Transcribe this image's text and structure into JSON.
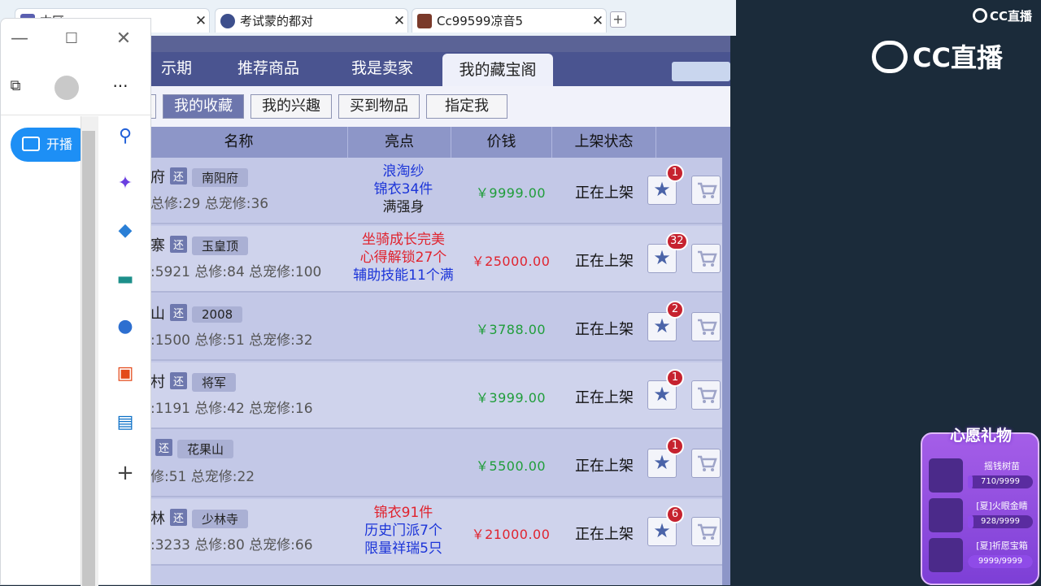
{
  "browser_tabs": [
    {
      "title": "本区"
    },
    {
      "title": "考试蒙的都对"
    },
    {
      "title": "Cc99599凉音5"
    }
  ],
  "game": {
    "tabs": [
      "示期",
      "推荐商品",
      "我是卖家",
      "我的藏宝阁"
    ],
    "active_tab": "我的藏宝阁",
    "filters": [
      "我的收藏",
      "我的兴趣",
      "买到物品",
      "指定我"
    ],
    "selected_filter": "我的收藏",
    "columns": [
      "名称",
      "亮点",
      "价钱",
      "上架状态"
    ],
    "rows": [
      {
        "name": "府",
        "server": "南阳府",
        "stats": "总修:29  总宠修:36",
        "highlights": [
          "浪淘纱",
          "锦衣34件",
          "满强身"
        ],
        "price": "￥9999.00",
        "price_color": "#1f9d3a",
        "status": "正在上架",
        "count": "1"
      },
      {
        "name": "寨",
        "server": "玉皇顶",
        "stats": ":5921  总修:84  总宠修:100",
        "highlights": [
          "坐骑成长完美",
          "心得解锁27个",
          "辅助技能11个满"
        ],
        "price": "￥25000.00",
        "price_color": "#e0232e",
        "status": "正在上架",
        "count": "32"
      },
      {
        "name": "山",
        "server": "2008",
        "stats": ":1500  总修:51  总宠修:32",
        "highlights": [],
        "price": "￥3788.00",
        "price_color": "#1f9d3a",
        "status": "正在上架",
        "count": "2"
      },
      {
        "name": "村",
        "server": "将军",
        "stats": ":1191  总修:42  总宠修:16",
        "highlights": [],
        "price": "￥3999.00",
        "price_color": "#1f9d3a",
        "status": "正在上架",
        "count": "1"
      },
      {
        "name": "",
        "server": "花果山",
        "stats": "修:51  总宠修:22",
        "highlights": [],
        "price": "￥5500.00",
        "price_color": "#1f9d3a",
        "status": "正在上架",
        "count": "1"
      },
      {
        "name": "林",
        "server": "少林寺",
        "stats": ":3233  总修:80  总宠修:66",
        "highlights": [
          "锦衣91件",
          "历史门派7个",
          "限量祥瑞5只"
        ],
        "price": "￥21000.00",
        "price_color": "#e0232e",
        "status": "正在上架",
        "count": "6"
      }
    ],
    "tag_label": "还"
  },
  "edge_panel": {
    "open_live_label": "开播"
  },
  "cc": {
    "corner_logo": "CC直播",
    "big_logo": "CC直播"
  },
  "wish": {
    "title": "心愿礼物",
    "items": [
      {
        "name": "摇钱树苗",
        "progress": "710/9999",
        "fraction": 0.071
      },
      {
        "name": "[夏]火眼金睛",
        "progress": "928/9999",
        "fraction": 0.093
      },
      {
        "name": "[夏]祈愿宝箱",
        "progress": "9999/9999",
        "fraction": 1.0
      }
    ]
  },
  "colors": {
    "accent_blue": "#1d8ff5",
    "tab_bar": "#4a5490",
    "header": "#8d96c8"
  },
  "icons": [
    "search-icon",
    "sparkle-icon",
    "tag-icon",
    "briefcase-icon",
    "games-icon",
    "office-icon",
    "outlook-icon",
    "plus-icon",
    "star-icon",
    "cart-icon"
  ]
}
